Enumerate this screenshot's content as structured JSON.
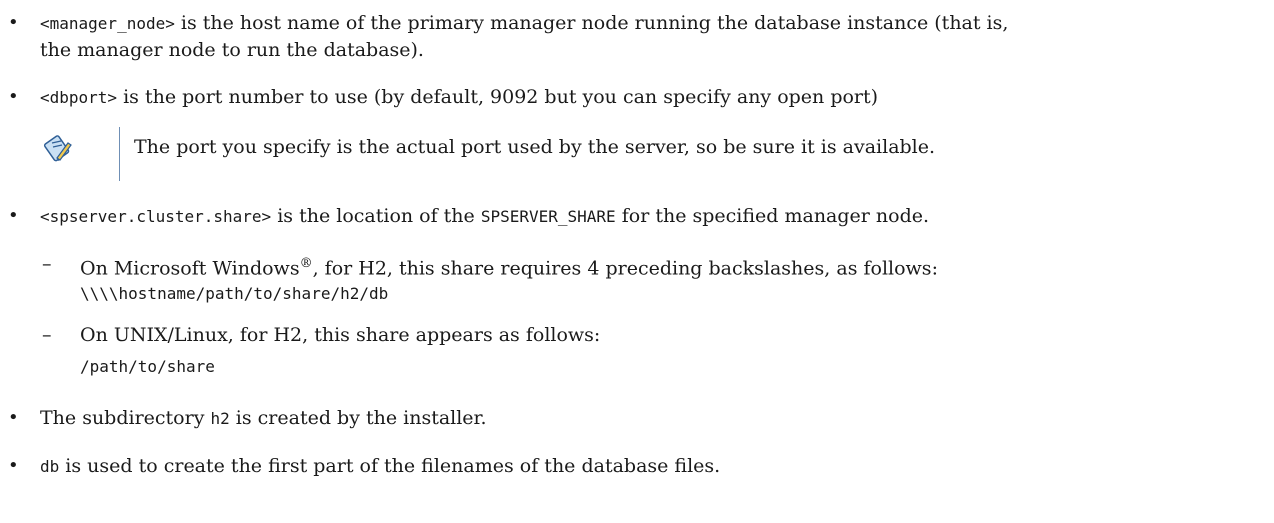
{
  "bullets": [
    {
      "symbol": "•",
      "code": "<manager_node>",
      "line1": " is the host name of the primary manager node running the database instance (that is,",
      "line2": "the manager node to run the database)."
    },
    {
      "symbol": "•",
      "code": "<dbport>",
      "text": " is the port number to use (by default, 9092 but you can specify any open port)"
    },
    {
      "symbol": "•",
      "code": "<spserver.cluster.share>",
      "text_before": " is the location of the ",
      "code2": "SPSERVER_SHARE",
      "text_after": " for the specified manager node."
    },
    {
      "symbol": "•",
      "text_before": "The subdirectory ",
      "code": "h2",
      "text_after": " is created by the installer."
    },
    {
      "symbol": "•",
      "code": "db",
      "text_after": " is used to create the first part of the filenames of the database files."
    }
  ],
  "note": {
    "icon": "note-pencil-icon",
    "text": "The port you specify is the actual port used by the server, so be sure it is available."
  },
  "subitems": [
    {
      "dash": "–",
      "text_before": "On Microsoft Windows",
      "superscript": "®",
      "text_after": ", for H2, this share requires 4 preceding backslashes, as follows:",
      "code": "\\\\\\\\hostname/path/to/share/h2/db"
    },
    {
      "dash": "–",
      "text": "On UNIX/Linux, for H2, this share appears as follows:",
      "code": "/path/to/share"
    }
  ]
}
